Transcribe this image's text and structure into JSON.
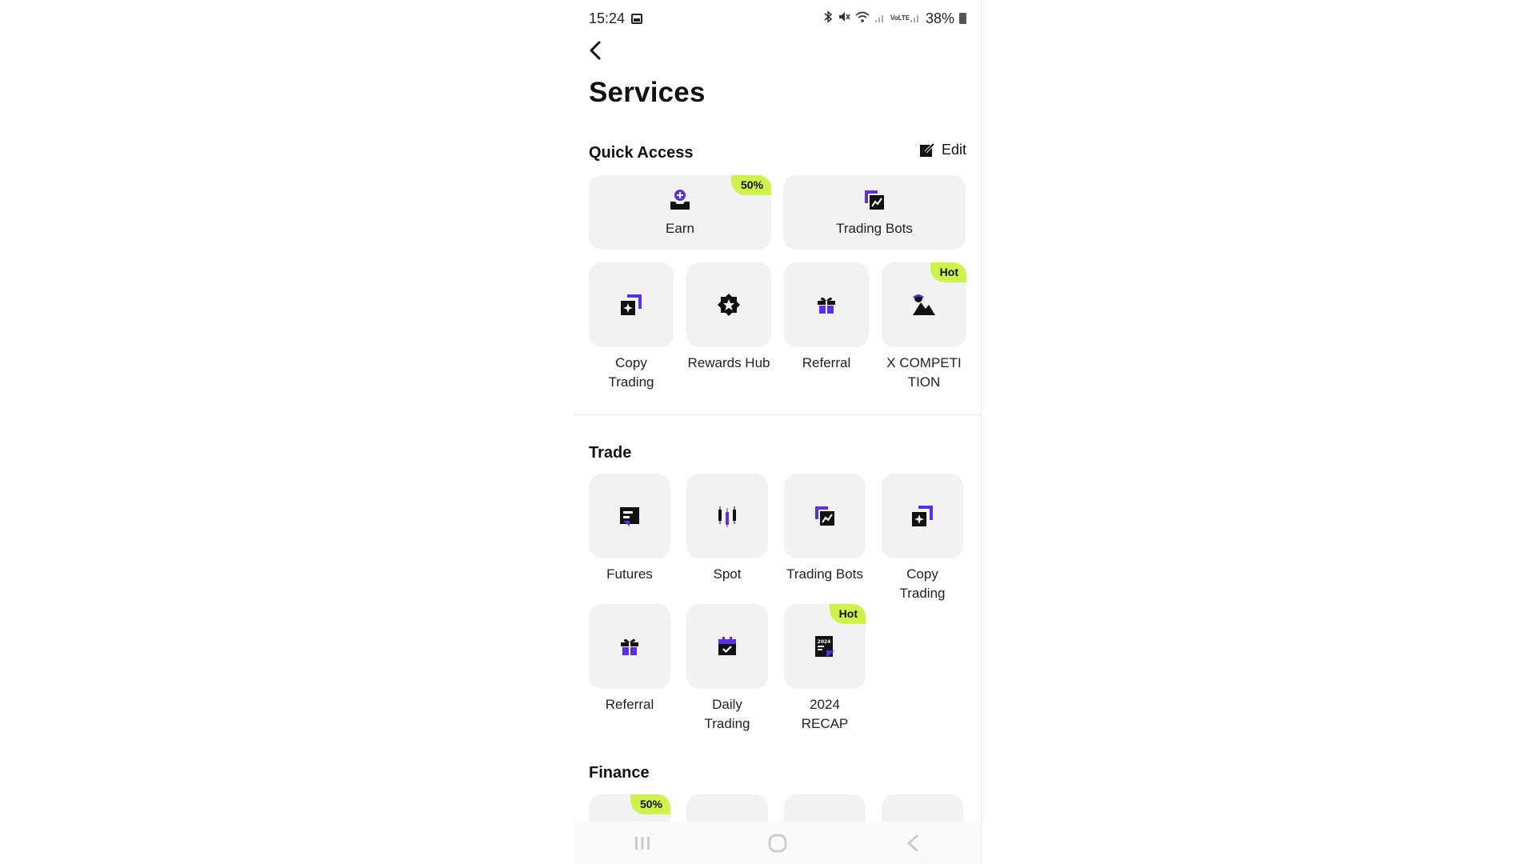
{
  "status_bar": {
    "time": "15:24",
    "battery": "38%",
    "icons": [
      "gallery-icon",
      "bluetooth-icon",
      "mute-icon",
      "wifi-icon",
      "signal-icon",
      "volte-icon",
      "signal-icon",
      "battery-icon"
    ],
    "volte_label": "VoLTE"
  },
  "header": {
    "title": "Services"
  },
  "quick_access": {
    "heading": "Quick Access",
    "edit_label": "Edit",
    "wide_items": [
      {
        "label": "Earn",
        "badge": "50%",
        "icon": "earn-icon"
      },
      {
        "label": "Trading Bots",
        "badge": "",
        "icon": "trading-bots-icon"
      }
    ],
    "items": [
      {
        "label_line1": "Copy",
        "label_line2": "Trading",
        "badge": "",
        "icon": "copy-trading-icon"
      },
      {
        "label_line1": "Rewards Hub",
        "label_line2": "",
        "badge": "",
        "icon": "rewards-hub-icon"
      },
      {
        "label_line1": "Referral",
        "label_line2": "",
        "badge": "",
        "icon": "gift-icon"
      },
      {
        "label_line1": "X  COMPETI",
        "label_line2": "TION",
        "badge": "Hot",
        "icon": "competition-icon"
      }
    ]
  },
  "trade": {
    "heading": "Trade",
    "items": [
      {
        "label_line1": "Futures",
        "label_line2": "",
        "badge": "",
        "icon": "futures-icon"
      },
      {
        "label_line1": "Spot",
        "label_line2": "",
        "badge": "",
        "icon": "spot-icon"
      },
      {
        "label_line1": "Trading Bots",
        "label_line2": "",
        "badge": "",
        "icon": "trading-bots-icon"
      },
      {
        "label_line1": "Copy",
        "label_line2": "Trading",
        "badge": "",
        "icon": "copy-trading-icon"
      },
      {
        "label_line1": "Referral",
        "label_line2": "",
        "badge": "",
        "icon": "gift-icon"
      },
      {
        "label_line1": "Daily",
        "label_line2": "Trading",
        "badge": "",
        "icon": "calendar-icon"
      },
      {
        "label_line1": "2024",
        "label_line2": "RECAP",
        "badge": "Hot",
        "icon": "recap-icon",
        "icon_text": "2024"
      }
    ]
  },
  "finance": {
    "heading": "Finance",
    "first_badge": "50%"
  },
  "colors": {
    "accent": "#5b2ee8",
    "badge": "#cdf24a",
    "tile": "#f2f2f2",
    "text": "#111111"
  },
  "navbar": {
    "icons": [
      "recent-apps-icon",
      "home-icon",
      "back-nav-icon"
    ]
  }
}
